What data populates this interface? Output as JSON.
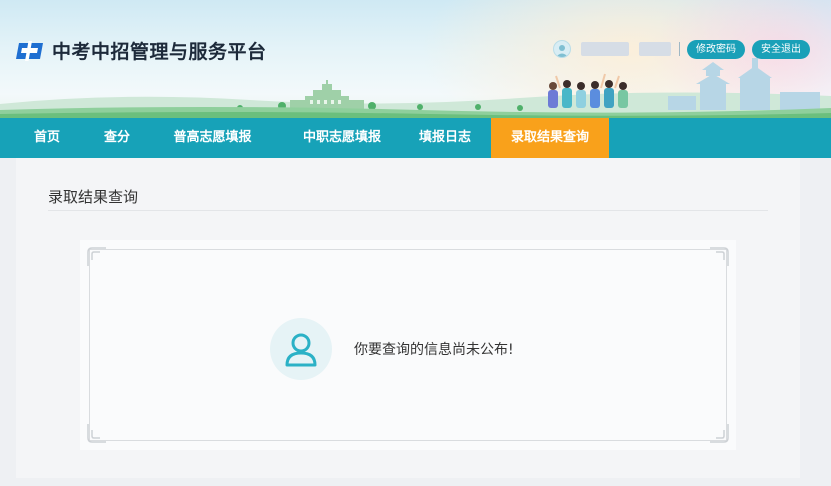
{
  "header": {
    "site_title": "中考中招管理与服务平台",
    "change_password_label": "修改密码",
    "logout_label": "安全退出"
  },
  "nav": {
    "items": [
      {
        "label": "首页",
        "active": false
      },
      {
        "label": "查分",
        "active": false
      },
      {
        "label": "普高志愿填报",
        "active": false
      },
      {
        "label": "中职志愿填报",
        "active": false
      },
      {
        "label": "填报日志",
        "active": false
      },
      {
        "label": "录取结果查询",
        "active": true
      }
    ]
  },
  "main": {
    "title": "录取结果查询",
    "message": "你要查询的信息尚未公布!"
  },
  "colors": {
    "nav_bg": "#17a2b8",
    "nav_active": "#f9a11b",
    "pill_button": "#1aa0b8",
    "logo_blue": "#1f6fd1"
  },
  "icons": {
    "logo": "brand-logo-icon",
    "user": "user-avatar-icon",
    "empty_state": "person-outline-icon"
  }
}
